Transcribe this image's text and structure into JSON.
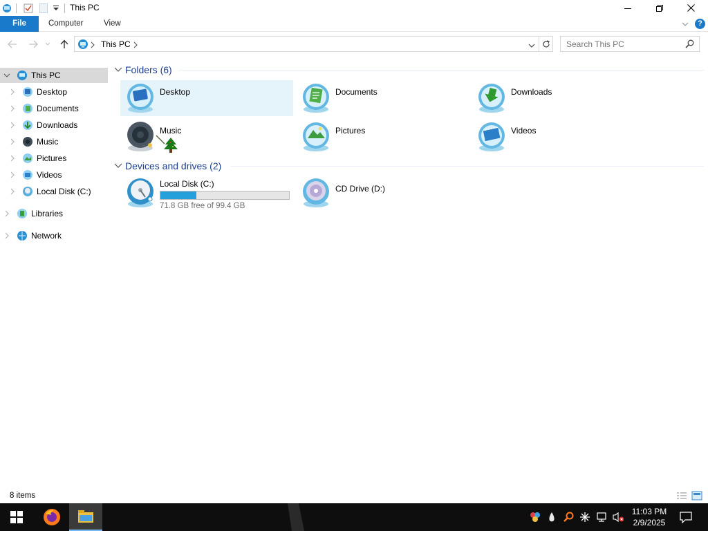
{
  "window": {
    "title": "This PC",
    "controls": {
      "minimize": "minimize",
      "maximize": "restore",
      "close": "close"
    }
  },
  "ribbon": {
    "tabs": [
      {
        "label": "File"
      },
      {
        "label": "Computer"
      },
      {
        "label": "View"
      }
    ],
    "help_label": "?"
  },
  "address": {
    "path": [
      "This PC"
    ],
    "search_placeholder": "Search This PC"
  },
  "nav_pane": {
    "items": [
      {
        "label": "This PC",
        "icon": "computer-icon",
        "level": 0,
        "selected": true,
        "expanded": true
      },
      {
        "label": "Desktop",
        "icon": "desktop-folder-icon",
        "level": 1
      },
      {
        "label": "Documents",
        "icon": "documents-folder-icon",
        "level": 1
      },
      {
        "label": "Downloads",
        "icon": "downloads-folder-icon",
        "level": 1
      },
      {
        "label": "Music",
        "icon": "music-folder-icon",
        "level": 1
      },
      {
        "label": "Pictures",
        "icon": "pictures-folder-icon",
        "level": 1
      },
      {
        "label": "Videos",
        "icon": "videos-folder-icon",
        "level": 1
      },
      {
        "label": "Local Disk (C:)",
        "icon": "local-disk-icon",
        "level": 1
      },
      {
        "label": "Libraries",
        "icon": "libraries-icon",
        "level": 0
      },
      {
        "label": "Network",
        "icon": "network-icon",
        "level": 0
      }
    ]
  },
  "content": {
    "folders_header": "Folders (6)",
    "folders": [
      {
        "label": "Desktop",
        "icon": "desktop-folder-icon",
        "selected": true
      },
      {
        "label": "Documents",
        "icon": "documents-folder-icon"
      },
      {
        "label": "Downloads",
        "icon": "downloads-folder-icon"
      },
      {
        "label": "Music",
        "icon": "music-folder-icon"
      },
      {
        "label": "Pictures",
        "icon": "pictures-folder-icon"
      },
      {
        "label": "Videos",
        "icon": "videos-folder-icon"
      }
    ],
    "drives_header": "Devices and drives (2)",
    "drives": [
      {
        "label": "Local Disk (C:)",
        "icon": "local-disk-icon",
        "free_text": "71.8 GB free of 99.4 GB",
        "used_fraction": 0.278
      },
      {
        "label": "CD Drive (D:)",
        "icon": "cd-drive-icon"
      }
    ]
  },
  "status": {
    "item_count": "8 items"
  },
  "taskbar": {
    "apps": [
      {
        "icon": "firefox-icon"
      },
      {
        "icon": "file-explorer-icon",
        "active": true
      }
    ],
    "clock": {
      "time": "11:03 PM",
      "date": "2/9/2025"
    }
  },
  "colors": {
    "accent": "#1979ca",
    "group_header": "#1e3f8f",
    "selection": "#e5f3fb",
    "progress": "#26a0da",
    "taskbar": "#0e0e0e"
  }
}
